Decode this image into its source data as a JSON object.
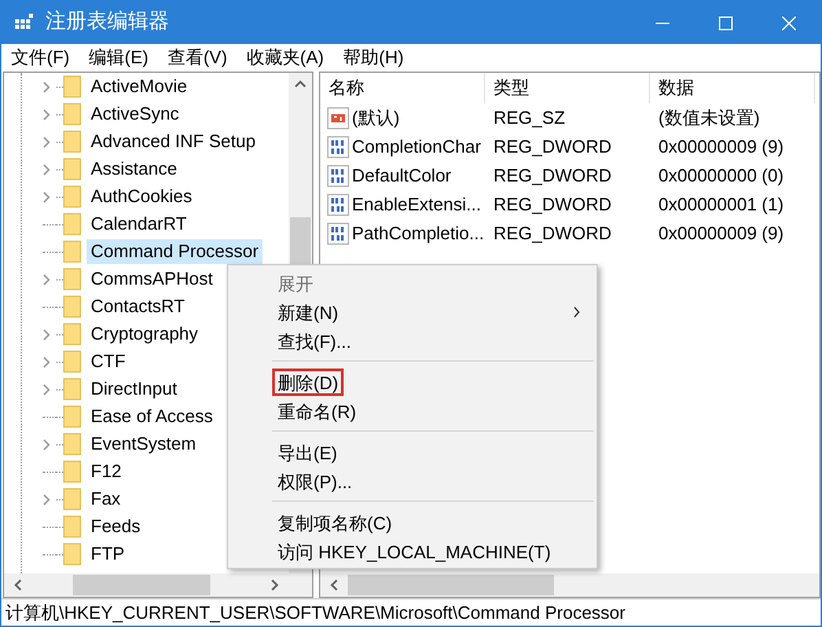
{
  "window": {
    "title": "注册表编辑器"
  },
  "menu_bar": [
    "文件(F)",
    "编辑(E)",
    "查看(V)",
    "收藏夹(A)",
    "帮助(H)"
  ],
  "tree": [
    {
      "label": "ActiveMovie",
      "expandable": true,
      "selected": false
    },
    {
      "label": "ActiveSync",
      "expandable": true,
      "selected": false
    },
    {
      "label": "Advanced INF Setup",
      "expandable": true,
      "selected": false
    },
    {
      "label": "Assistance",
      "expandable": true,
      "selected": false
    },
    {
      "label": "AuthCookies",
      "expandable": true,
      "selected": false
    },
    {
      "label": "CalendarRT",
      "expandable": false,
      "selected": false
    },
    {
      "label": "Command Processor",
      "expandable": false,
      "selected": true
    },
    {
      "label": "CommsAPHost",
      "expandable": true,
      "selected": false
    },
    {
      "label": "ContactsRT",
      "expandable": false,
      "selected": false
    },
    {
      "label": "Cryptography",
      "expandable": true,
      "selected": false
    },
    {
      "label": "CTF",
      "expandable": true,
      "selected": false
    },
    {
      "label": "DirectInput",
      "expandable": true,
      "selected": false
    },
    {
      "label": "Ease of Access",
      "expandable": false,
      "selected": false
    },
    {
      "label": "EventSystem",
      "expandable": true,
      "selected": false
    },
    {
      "label": "F12",
      "expandable": false,
      "selected": false
    },
    {
      "label": "Fax",
      "expandable": true,
      "selected": false
    },
    {
      "label": "Feeds",
      "expandable": false,
      "selected": false
    },
    {
      "label": "FTP",
      "expandable": false,
      "selected": false
    }
  ],
  "table": {
    "columns": [
      "名称",
      "类型",
      "数据"
    ],
    "rows": [
      {
        "kind": "string",
        "name": "(默认)",
        "type": "REG_SZ",
        "data": "(数值未设置)"
      },
      {
        "kind": "binary",
        "name": "CompletionChar",
        "type": "REG_DWORD",
        "data": "0x00000009 (9)"
      },
      {
        "kind": "binary",
        "name": "DefaultColor",
        "type": "REG_DWORD",
        "data": "0x00000000 (0)"
      },
      {
        "kind": "binary",
        "name": "EnableExtensi...",
        "type": "REG_DWORD",
        "data": "0x00000001 (1)"
      },
      {
        "kind": "binary",
        "name": "PathCompletio...",
        "type": "REG_DWORD",
        "data": "0x00000009 (9)"
      }
    ]
  },
  "context_menu": [
    {
      "kind": "item",
      "label": "展开",
      "disabled": true,
      "submenu": false,
      "marked": false
    },
    {
      "kind": "item",
      "label": "新建(N)",
      "disabled": false,
      "submenu": true,
      "marked": false
    },
    {
      "kind": "item",
      "label": "查找(F)...",
      "disabled": false,
      "submenu": false,
      "marked": false
    },
    {
      "kind": "separator"
    },
    {
      "kind": "item",
      "label": "删除(D)",
      "disabled": false,
      "submenu": false,
      "marked": true
    },
    {
      "kind": "item",
      "label": "重命名(R)",
      "disabled": false,
      "submenu": false,
      "marked": false
    },
    {
      "kind": "separator"
    },
    {
      "kind": "item",
      "label": "导出(E)",
      "disabled": false,
      "submenu": false,
      "marked": false
    },
    {
      "kind": "item",
      "label": "权限(P)...",
      "disabled": false,
      "submenu": false,
      "marked": false
    },
    {
      "kind": "separator"
    },
    {
      "kind": "item",
      "label": "复制项名称(C)",
      "disabled": false,
      "submenu": false,
      "marked": false
    },
    {
      "kind": "item",
      "label": "访问 HKEY_LOCAL_MACHINE(T)",
      "disabled": false,
      "submenu": false,
      "marked": false
    }
  ],
  "status_bar": "计算机\\HKEY_CURRENT_USER\\SOFTWARE\\Microsoft\\Command Processor"
}
